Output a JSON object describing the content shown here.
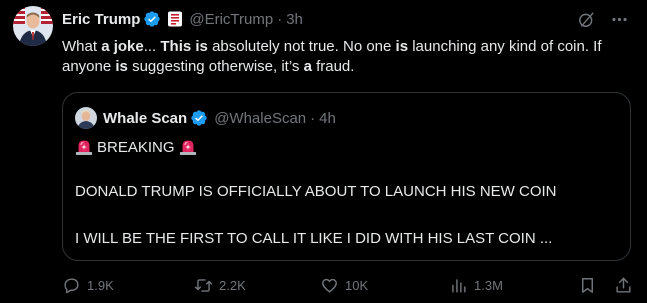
{
  "author": {
    "name": "Eric Trump",
    "handle": "@EricTrump",
    "time": "3h"
  },
  "tweet": {
    "segments": [
      {
        "t": "What ",
        "b": false
      },
      {
        "t": "a joke",
        "b": true
      },
      {
        "t": "... ",
        "b": false
      },
      {
        "t": "This is",
        "b": true
      },
      {
        "t": " absolutely not true. No one ",
        "b": false
      },
      {
        "t": "is",
        "b": true
      },
      {
        "t": " launching any kind of coin. If anyone ",
        "b": false
      },
      {
        "t": "is",
        "b": true
      },
      {
        "t": " suggesting otherwise, it’s ",
        "b": false
      },
      {
        "t": "a",
        "b": true
      },
      {
        "t": " fraud.",
        "b": false
      }
    ]
  },
  "quote": {
    "name": "Whale Scan",
    "handle": "@WhaleScan",
    "time": "4h",
    "line1": "BREAKING",
    "line2": "DONALD TRUMP IS OFFICIALLY ABOUT TO LAUNCH HIS NEW COIN",
    "line3": "I WILL BE THE FIRST TO CALL IT LIKE I DID WITH HIS LAST COIN ..."
  },
  "stats": {
    "replies": "1.9K",
    "reposts": "2.2K",
    "likes": "10K",
    "views": "1.3M"
  },
  "colors": {
    "verified": "#1d9bf0",
    "muted": "#71767b",
    "border": "#2f3336",
    "siren": "#e0245e"
  },
  "icons": [
    "verified-icon",
    "flag-badge-icon",
    "grok-icon",
    "more-icon",
    "siren-icon",
    "reply-icon",
    "repost-icon",
    "like-icon",
    "views-icon",
    "bookmark-icon",
    "share-icon"
  ]
}
